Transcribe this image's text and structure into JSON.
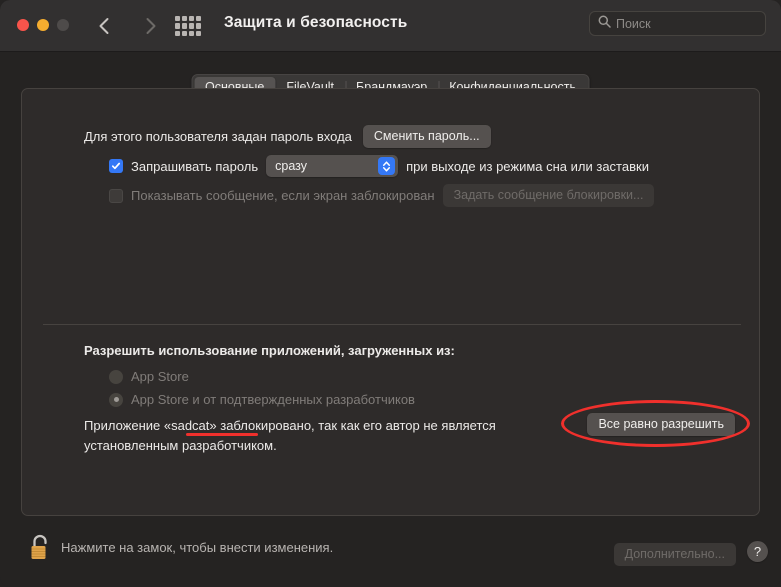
{
  "window": {
    "title": "Защита и безопасность",
    "traffic_lights": [
      "close",
      "minimize",
      "zoom"
    ],
    "nav": {
      "back": "back-arrow",
      "forward": "forward-arrow"
    },
    "grid_icon": "all-preferences-grid-icon"
  },
  "search": {
    "placeholder": "Поиск",
    "value": "",
    "icon": "search-icon"
  },
  "tabs": [
    {
      "label": "Основные",
      "active": true
    },
    {
      "label": "FileVault",
      "active": false
    },
    {
      "label": "Брандмауэр",
      "active": false
    },
    {
      "label": "Конфиденциальность",
      "active": false
    }
  ],
  "login_password": {
    "text": "Для этого пользователя задан пароль входа",
    "change_button": "Сменить пароль..."
  },
  "require_password": {
    "checked": true,
    "label": "Запрашивать пароль",
    "delay_value": "сразу",
    "suffix": "при выходе из режима сна или заставки"
  },
  "lock_message": {
    "checked": false,
    "enabled": false,
    "label": "Показывать сообщение, если экран заблокирован",
    "set_button": "Задать сообщение блокировки..."
  },
  "allow_apps": {
    "heading": "Разрешить использование приложений, загруженных из:",
    "options": [
      {
        "label": "App Store",
        "selected": false,
        "enabled": false
      },
      {
        "label": "App Store и от подтвержденных разработчиков",
        "selected": true,
        "enabled": false
      }
    ],
    "blocked_message_line1": "Приложение «sadcat» заблокировано, так как его автор не является",
    "blocked_message_line2": "установленным разработчиком.",
    "blocked_app_name": "«sadcat»",
    "allow_anyway_button": "Все равно разрешить"
  },
  "footer": {
    "lock_icon": "unlocked-padlock-icon",
    "lock_note": "Нажмите на замок, чтобы внести изменения.",
    "advanced_button": "Дополнительно...",
    "help_button": "?"
  },
  "annotations": {
    "underline_color": "#f0302c",
    "ellipse_color": "#f0302c"
  },
  "colors": {
    "window_bg": "#252322",
    "titlebar_bg": "#323030",
    "panel_bg": "#2e2b2a",
    "accent_blue": "#3478f6",
    "lock_gold": "#e0a34a"
  }
}
